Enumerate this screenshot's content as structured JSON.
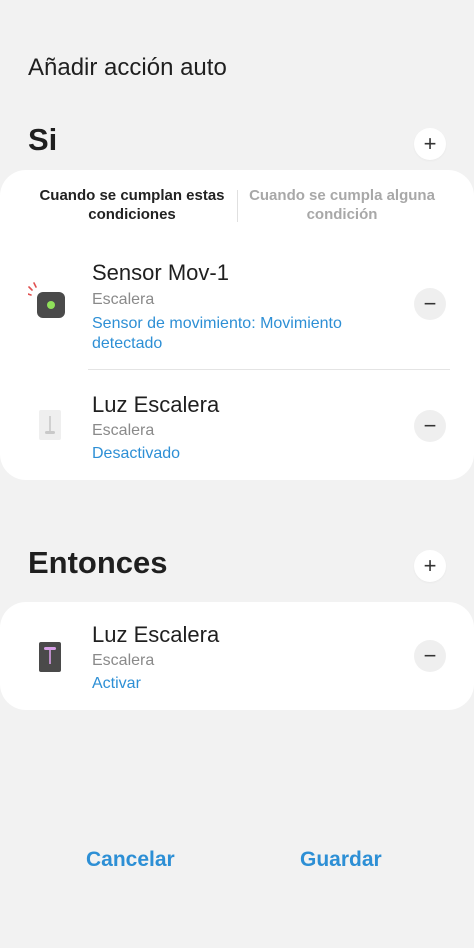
{
  "page": {
    "title": "Añadir acción auto"
  },
  "si": {
    "title": "Si",
    "add_icon": "plus-icon",
    "tabs": [
      {
        "label": "Cuando se cumplan estas condiciones",
        "active": true
      },
      {
        "label": "Cuando se cumpla alguna condición",
        "active": false
      }
    ],
    "devices": [
      {
        "name": "Sensor Mov-1",
        "room": "Escalera",
        "status": "Sensor de movimiento: Movimiento detectado",
        "icon": "motion-sensor-icon"
      },
      {
        "name": "Luz Escalera",
        "room": "Escalera",
        "status": "Desactivado",
        "icon": "light-switch-off-icon"
      }
    ]
  },
  "entonces": {
    "title": "Entonces",
    "add_icon": "plus-icon",
    "devices": [
      {
        "name": "Luz Escalera",
        "room": "Escalera",
        "status": "Activar",
        "icon": "light-switch-on-icon"
      }
    ]
  },
  "footer": {
    "cancel_label": "Cancelar",
    "save_label": "Guardar"
  },
  "colors": {
    "background": "#f2f2f2",
    "card": "#ffffff",
    "accent": "#2d8fd5",
    "secondary_text": "#8a8a8a",
    "inactive_tab": "#a8a8a8"
  }
}
